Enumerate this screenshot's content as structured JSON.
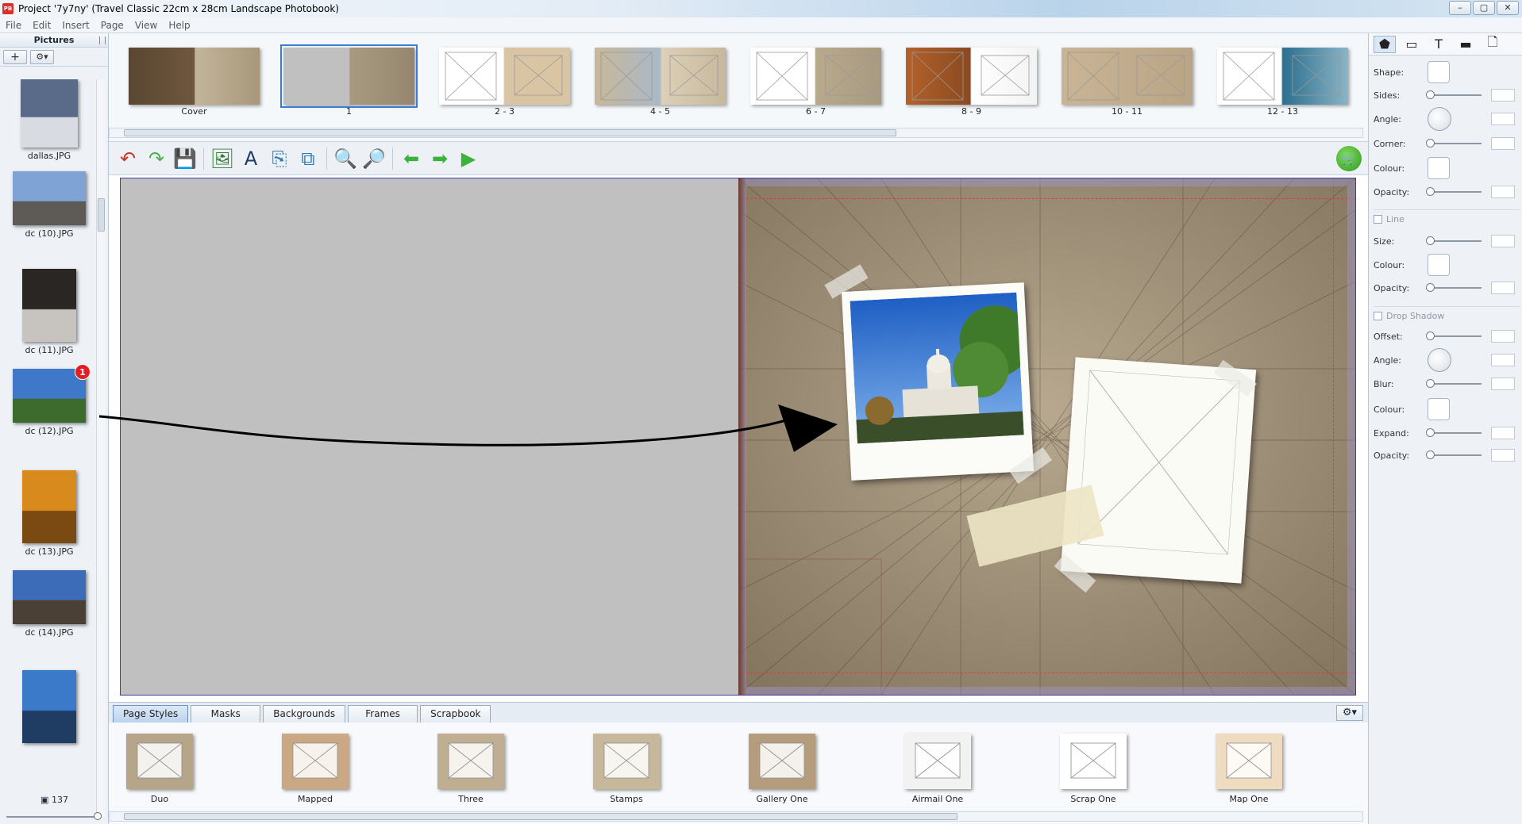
{
  "window": {
    "title": "Project '7y7ny' (Travel Classic 22cm x 28cm Landscape Photobook)",
    "app_icon_text": "PB",
    "controls": [
      "–",
      "▢",
      "✕"
    ]
  },
  "menu": [
    "File",
    "Edit",
    "Insert",
    "Page",
    "View",
    "Help"
  ],
  "pictures_panel": {
    "title": "Pictures",
    "add_label": "+",
    "gear_label": "⚙▾",
    "items": [
      {
        "label": "dallas.JPG",
        "colors": [
          "#5a6b8a",
          "#d8dce2"
        ]
      },
      {
        "label": "dc (10).JPG",
        "colors": [
          "#7fa3d4",
          "#5e5a55"
        ]
      },
      {
        "label": "dc (11).JPG",
        "colors": [
          "#2a2624",
          "#c7c3be"
        ]
      },
      {
        "label": "dc (12).JPG",
        "colors": [
          "#3f78c8",
          "#3d6b2e"
        ],
        "badge": "1"
      },
      {
        "label": "dc (13).JPG",
        "colors": [
          "#d98a1c",
          "#7a4a12"
        ]
      },
      {
        "label": "dc (14).JPG",
        "colors": [
          "#3c6bb8",
          "#4a4036"
        ]
      },
      {
        "label": "",
        "colors": [
          "#3b79c9",
          "#1f3d63"
        ]
      }
    ],
    "count": "137",
    "count_icon": "▣"
  },
  "pages": [
    {
      "label": "Cover",
      "style": "cover"
    },
    {
      "label": "1",
      "style": "one",
      "selected": true
    },
    {
      "label": "2 - 3",
      "style": "plain"
    },
    {
      "label": "4 - 5",
      "style": "stamps"
    },
    {
      "label": "6 - 7",
      "style": "grid"
    },
    {
      "label": "8 - 9",
      "style": "wood"
    },
    {
      "label": "10 - 11",
      "style": "gallery"
    },
    {
      "label": "12 - 13",
      "style": "sea"
    }
  ],
  "toolbar": {
    "buttons": [
      {
        "name": "undo-button",
        "icon": "↶",
        "color": "#c0392b"
      },
      {
        "name": "redo-button",
        "icon": "↷",
        "color": "#4caf50"
      },
      {
        "name": "save-button",
        "icon": "💾",
        "color": "#3a4f6a"
      },
      {
        "name": "add-picture-button",
        "icon": "🖼",
        "color": "#2e7d32"
      },
      {
        "name": "add-text-button",
        "icon": "A",
        "color": "#1e3d6a"
      },
      {
        "name": "add-page-button",
        "icon": "⎘",
        "color": "#2a7bb5"
      },
      {
        "name": "duplicate-page-button",
        "icon": "⧉",
        "color": "#2a7bb5"
      },
      {
        "name": "zoom-out-button",
        "icon": "🔍",
        "color": "#555"
      },
      {
        "name": "zoom-in-button",
        "icon": "🔎",
        "color": "#555"
      },
      {
        "name": "prev-page-button",
        "icon": "⬅",
        "color": "#3bb33b"
      },
      {
        "name": "next-page-button",
        "icon": "➡",
        "color": "#3bb33b"
      },
      {
        "name": "play-button",
        "icon": "▶",
        "color": "#3bb33b"
      }
    ],
    "cart_icon": "🛒"
  },
  "tabs": {
    "items": [
      "Page Styles",
      "Masks",
      "Backgrounds",
      "Frames",
      "Scrapbook"
    ],
    "active": "Page Styles",
    "gear_label": "⚙▾"
  },
  "page_styles": [
    {
      "label": "Duo",
      "bg": "#b7a58a"
    },
    {
      "label": "Mapped",
      "bg": "#c9a883"
    },
    {
      "label": "Three",
      "bg": "#bfae92"
    },
    {
      "label": "Stamps",
      "bg": "#c7b89c"
    },
    {
      "label": "Gallery One",
      "bg": "#b59c7c"
    },
    {
      "label": "Airmail One",
      "bg": "#f2f2f2"
    },
    {
      "label": "Scrap One",
      "bg": "#ffffff"
    },
    {
      "label": "Map One",
      "bg": "#efdcc0"
    }
  ],
  "properties": {
    "tabs": [
      "⬟",
      "▭",
      "T",
      "▬",
      "🗋"
    ],
    "shape_rows": [
      {
        "label": "Shape:",
        "control": "swatch"
      },
      {
        "label": "Sides:",
        "control": "slider"
      },
      {
        "label": "Angle:",
        "control": "dial"
      },
      {
        "label": "Corner:",
        "control": "slider"
      },
      {
        "label": "Colour:",
        "control": "swatch"
      },
      {
        "label": "Opacity:",
        "control": "slider"
      }
    ],
    "line_section": "Line",
    "line_rows": [
      {
        "label": "Size:",
        "control": "slider"
      },
      {
        "label": "Colour:",
        "control": "swatch"
      },
      {
        "label": "Opacity:",
        "control": "slider"
      }
    ],
    "shadow_section": "Drop Shadow",
    "shadow_rows": [
      {
        "label": "Offset:",
        "control": "slider"
      },
      {
        "label": "Angle:",
        "control": "dial"
      },
      {
        "label": "Blur:",
        "control": "slider"
      },
      {
        "label": "Colour:",
        "control": "swatch"
      },
      {
        "label": "Expand:",
        "control": "slider"
      },
      {
        "label": "Opacity:",
        "control": "slider"
      }
    ]
  },
  "colors": {
    "accent": "#3a7bd5",
    "map_bg": "#a0907a",
    "left_page": "#c0c0c0"
  }
}
